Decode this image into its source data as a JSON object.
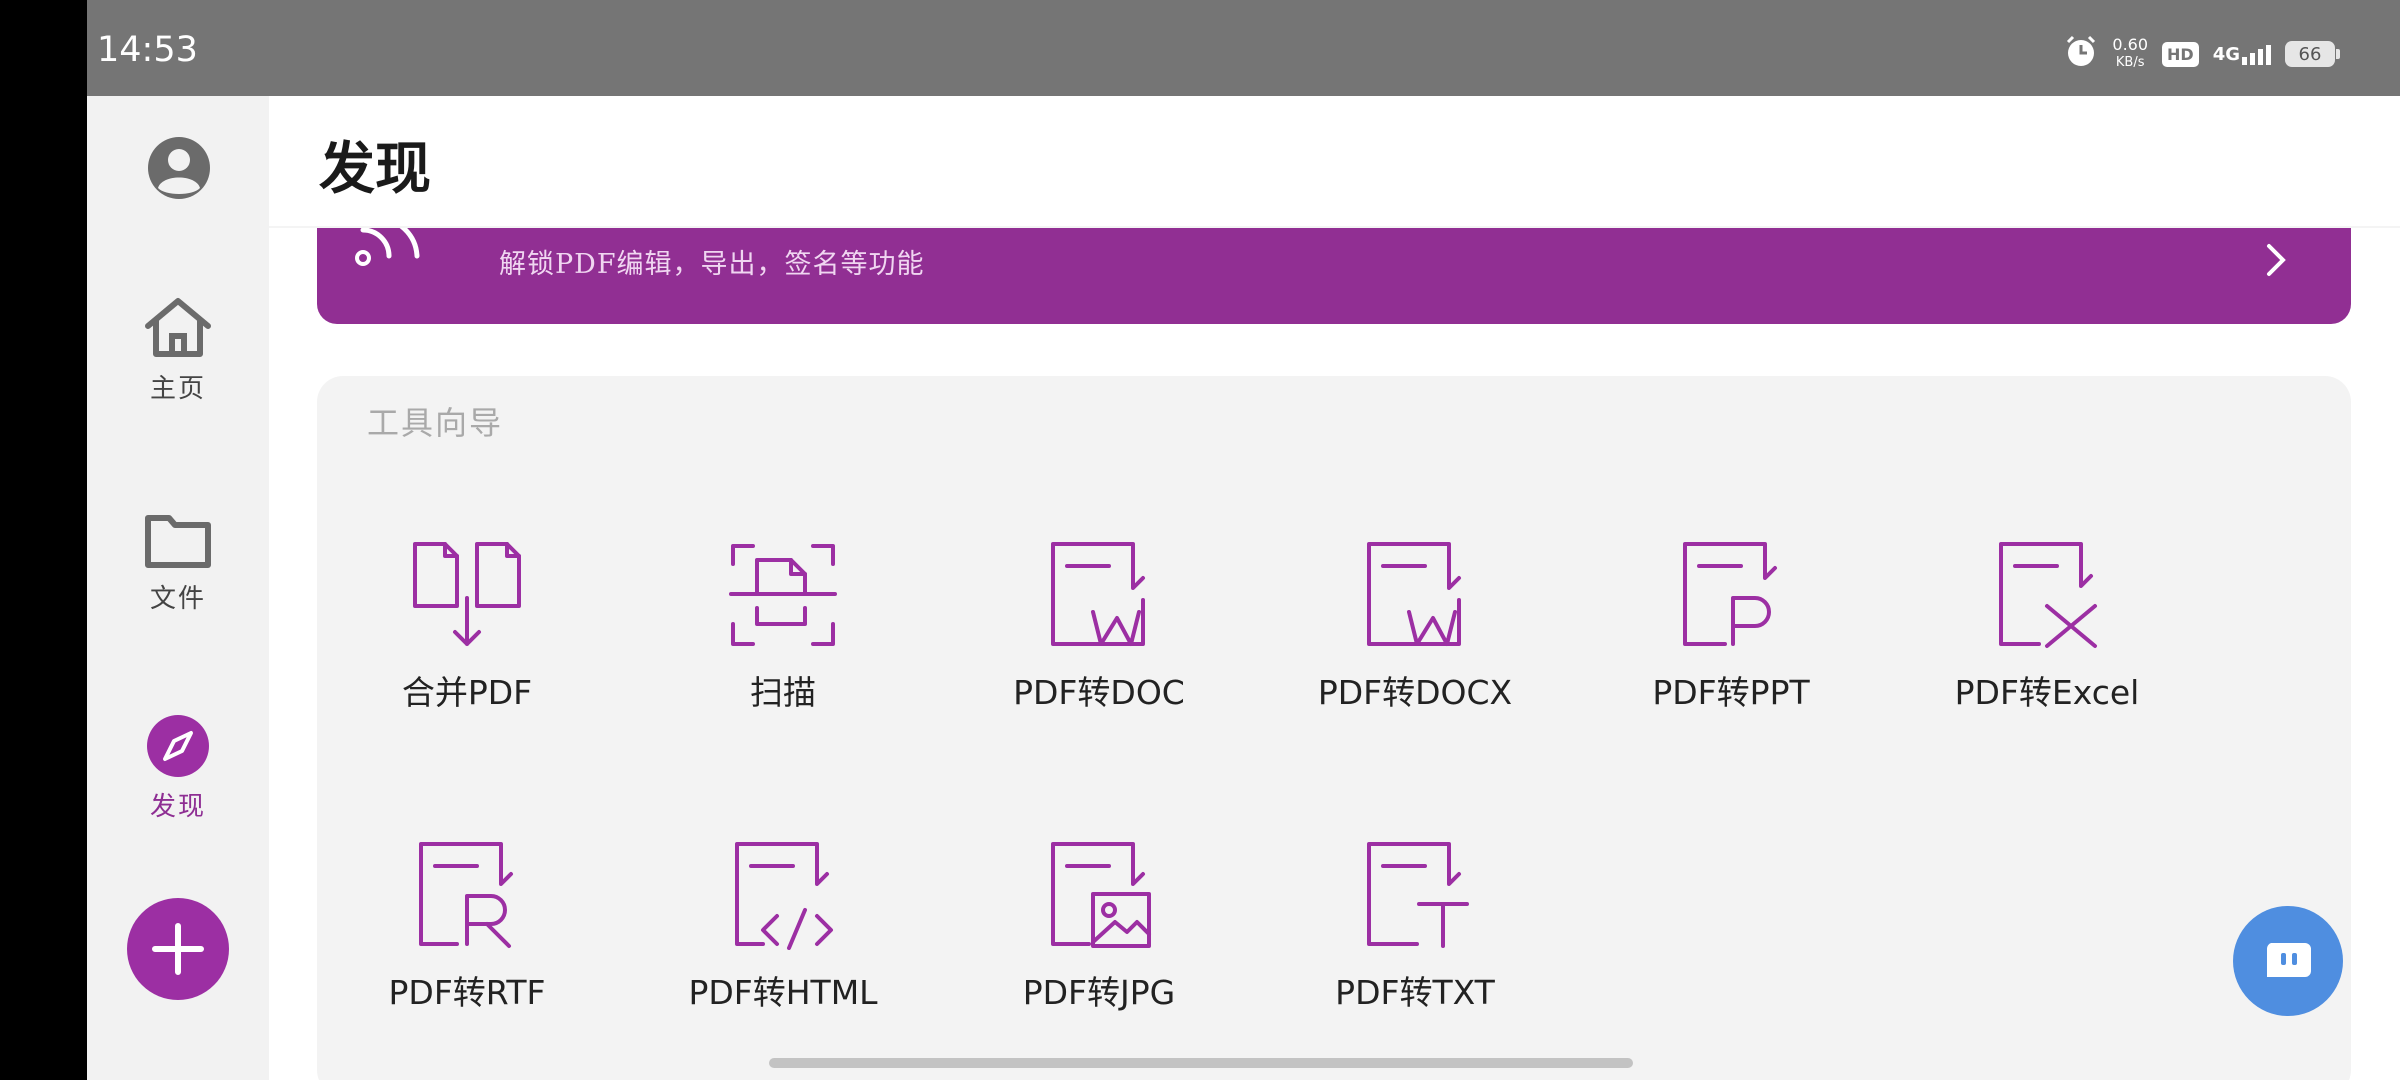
{
  "status_bar": {
    "time": "14:53",
    "net_speed_value": "0.60",
    "net_speed_unit": "KB/s",
    "hd_label": "HD",
    "network_type": "4G",
    "battery": "66"
  },
  "sidebar": {
    "items": [
      {
        "label": "主页",
        "icon": "home-icon"
      },
      {
        "label": "文件",
        "icon": "folder-icon"
      },
      {
        "label": "发现",
        "icon": "compass-icon"
      }
    ],
    "add_icon": "plus-icon"
  },
  "header": {
    "title": "发现"
  },
  "promo": {
    "subtitle": "解锁PDF编辑，导出，签名等功能"
  },
  "tools": {
    "title": "工具向导",
    "items": [
      {
        "label": "合并PDF",
        "icon": "merge-pdf-icon"
      },
      {
        "label": "扫描",
        "icon": "scan-icon"
      },
      {
        "label": "PDF转DOC",
        "icon": "pdf-to-doc-icon"
      },
      {
        "label": "PDF转DOCX",
        "icon": "pdf-to-docx-icon"
      },
      {
        "label": "PDF转PPT",
        "icon": "pdf-to-ppt-icon"
      },
      {
        "label": "PDF转Excel",
        "icon": "pdf-to-excel-icon"
      },
      {
        "label": "PDF转RTF",
        "icon": "pdf-to-rtf-icon"
      },
      {
        "label": "PDF转HTML",
        "icon": "pdf-to-html-icon"
      },
      {
        "label": "PDF转JPG",
        "icon": "pdf-to-jpg-icon"
      },
      {
        "label": "PDF转TXT",
        "icon": "pdf-to-txt-icon"
      }
    ]
  },
  "colors": {
    "accent": "#9c2fa3",
    "banner": "#912f93",
    "chat_fab": "#4f8ee0",
    "status_bar": "#757575",
    "panel": "#f3f3f3"
  },
  "chat_fab_icon": "chat-bot-icon"
}
